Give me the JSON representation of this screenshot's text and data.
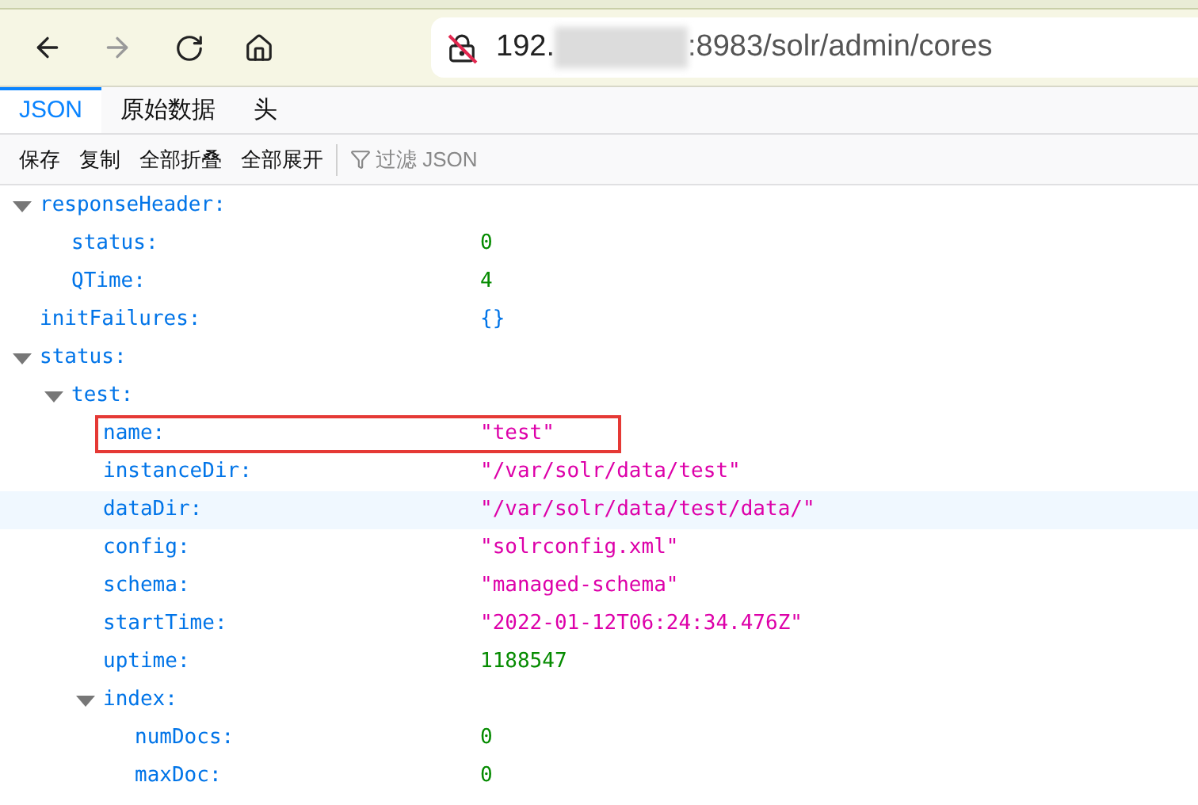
{
  "address_bar": {
    "url_start": "192.",
    "url_end": ":8983/solr/admin/cores"
  },
  "tabs": [
    {
      "label": "JSON",
      "selected": true
    },
    {
      "label": "原始数据",
      "selected": false
    },
    {
      "label": "头",
      "selected": false
    }
  ],
  "toolbar": {
    "buttons": [
      "保存",
      "复制",
      "全部折叠",
      "全部展开"
    ],
    "filter": {
      "placeholder": "过滤 JSON"
    }
  },
  "tree": [
    {
      "key": "responseHeader:",
      "expanded": true,
      "highlighted": false,
      "boxed": false,
      "children": [
        {
          "key": "status:",
          "value": "0",
          "color": "#058b00",
          "highlighted": false,
          "boxed": false
        },
        {
          "key": "QTime:",
          "value": "4",
          "color": "#058b00",
          "highlighted": false,
          "boxed": false
        }
      ]
    },
    {
      "key": "initFailures:",
      "value": "{}",
      "color": "#0074e8",
      "highlighted": false,
      "boxed": false
    },
    {
      "key": "status:",
      "expanded": true,
      "highlighted": false,
      "boxed": false,
      "children": [
        {
          "key": "test:",
          "expanded": true,
          "highlighted": false,
          "boxed": false,
          "children": [
            {
              "key": "name:",
              "value": "\"test\"",
              "color": "#dd00a9",
              "highlighted": false,
              "boxed": true
            },
            {
              "key": "instanceDir:",
              "value": "\"/var/solr/data/test\"",
              "color": "#dd00a9",
              "highlighted": false,
              "boxed": false
            },
            {
              "key": "dataDir:",
              "value": "\"/var/solr/data/test/data/\"",
              "color": "#dd00a9",
              "highlighted": true,
              "boxed": false
            },
            {
              "key": "config:",
              "value": "\"solrconfig.xml\"",
              "color": "#dd00a9",
              "highlighted": false,
              "boxed": false
            },
            {
              "key": "schema:",
              "value": "\"managed-schema\"",
              "color": "#dd00a9",
              "highlighted": false,
              "boxed": false
            },
            {
              "key": "startTime:",
              "value": "\"2022-01-12T06:24:34.476Z\"",
              "color": "#dd00a9",
              "highlighted": false,
              "boxed": false
            },
            {
              "key": "uptime:",
              "value": "1188547",
              "color": "#058b00",
              "highlighted": false,
              "boxed": false
            },
            {
              "key": "index:",
              "expanded": true,
              "highlighted": false,
              "boxed": false,
              "children": [
                {
                  "key": "numDocs:",
                  "value": "0",
                  "color": "#058b00",
                  "highlighted": false,
                  "boxed": false
                },
                {
                  "key": "maxDoc:",
                  "value": "0",
                  "color": "#058b00",
                  "highlighted": false,
                  "boxed": false
                }
              ]
            }
          ]
        }
      ]
    }
  ]
}
